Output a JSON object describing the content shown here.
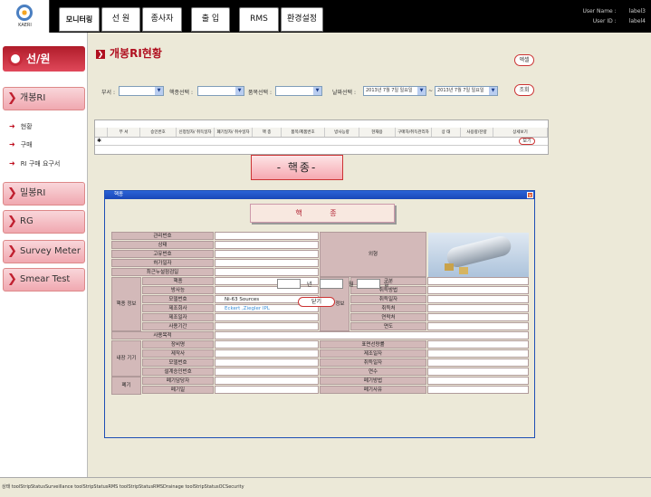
{
  "app": {
    "logo_text": "KAERI"
  },
  "nav": [
    "모니터링",
    "선 원",
    "종사자",
    "출 입",
    "RMS",
    "환경설정"
  ],
  "user": {
    "name_label": "User Name :",
    "name": "label3",
    "id_label": "User ID :",
    "id": "label4"
  },
  "sidebar": {
    "title": "선/원",
    "menus": [
      "개봉RI",
      "밀봉RI",
      "RG",
      "Survey Meter",
      "Smear Test"
    ],
    "sub_items": [
      "현황",
      "구매",
      "RI 구매 요구서"
    ]
  },
  "page": {
    "title": "개봉RI현황",
    "excel_btn": "엑셀",
    "search_btn": "조회"
  },
  "filters": {
    "dept_label": "부서 :",
    "nuclide_label": "핵종선택 :",
    "item_label": "품목선택 :",
    "date_label": "날짜선택 :",
    "date_from": "2013년  7월  7일 일요일",
    "date_sep": "~",
    "date_to": "2013년  7월  7일 일요일"
  },
  "grid": {
    "columns": [
      "부 서",
      "승인번호",
      "신청일자/ 취득일자",
      "폐기일자/ 취수일자",
      "핵 종",
      "품목/제품번호",
      "방사능량",
      "현재용",
      "구매자/취득관리자",
      "상 태",
      "사용량/잔량",
      "상세보기"
    ],
    "detail_btn": "보기"
  },
  "banner": "- 핵종-",
  "dialog": {
    "title": "핵종",
    "header": "핵  종",
    "rows_left": [
      "관리번호",
      "상태",
      "고유번호",
      "허가일자",
      "최근누설점검일"
    ],
    "group1_label": "핵종 정보",
    "group1_rows": [
      "핵종",
      "방사능",
      "모델번호",
      "제조회사",
      "제조일자",
      "사용기간"
    ],
    "model_no": "Ni-63 Sources",
    "maker": "Eckert ,Ziegler IPL",
    "use_purpose": "사용목적",
    "group2_label": "내장 기기",
    "group2_rows": [
      "장비명",
      "제작사",
      "모델번호",
      "설계승인번호"
    ],
    "group3_label": "폐기",
    "group3_rows": [
      "폐기담당자",
      "폐기일"
    ],
    "appearance_label": "외형",
    "acq_label": "취득 정보",
    "acq_rows": [
      "구분",
      "취득방법",
      "취득일자",
      "취득처",
      "연락처",
      "면도"
    ],
    "right2_rows": [
      "표면선량률",
      "제조일자",
      "취득일자",
      "연수",
      "폐기방법",
      "폐기사유"
    ],
    "year_lbl": "년",
    "month_lbl": "월",
    "day_lbl": "일",
    "close_btn": "닫기"
  },
  "statusbar": "상태  toolStripStatusSurveillance  toolStripStatusRMS  toolStripStatusRMSDrainage  toolStripStatusOCSecurity"
}
